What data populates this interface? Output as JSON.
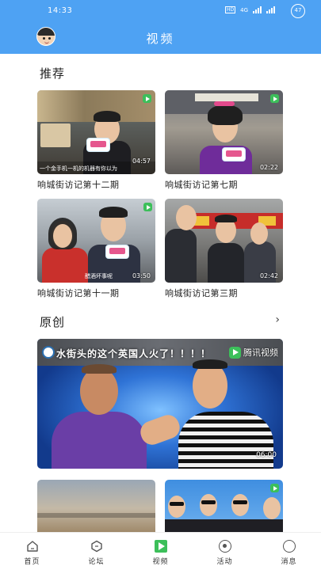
{
  "status_bar": {
    "time": "14:33",
    "network": "4G",
    "battery": "47"
  },
  "header": {
    "title": "视频",
    "avatar_icon": "avatar-icon"
  },
  "sections": {
    "recommended": {
      "title": "推荐"
    },
    "original": {
      "title": "原创",
      "more_icon": "chevron-right-icon"
    }
  },
  "recommended_videos": [
    {
      "caption": "响城街访记第十二期",
      "duration": "04:57",
      "subtitle": "一个金手机一机的机器有你以为"
    },
    {
      "caption": "响城街访记第七期",
      "duration": "02:22"
    },
    {
      "caption": "响城街访记第十一期",
      "duration": "03:50",
      "subtitle": "醋酒坏事呢"
    },
    {
      "caption": "响城街访记第三期",
      "duration": "02:42"
    }
  ],
  "original_videos": [
    {
      "title": "水街头的这个英国人火了！！！！",
      "duration": "06:00",
      "brand": "腾讯视频"
    }
  ],
  "tabbar": {
    "items": [
      {
        "label": "首页",
        "icon": "home-icon"
      },
      {
        "label": "论坛",
        "icon": "forum-icon"
      },
      {
        "label": "视频",
        "icon": "video-icon"
      },
      {
        "label": "活动",
        "icon": "event-icon"
      },
      {
        "label": "消息",
        "icon": "message-icon"
      }
    ],
    "active": "视频"
  },
  "colors": {
    "header": "#4ea2f3",
    "accent_green": "#3cbf5a"
  }
}
